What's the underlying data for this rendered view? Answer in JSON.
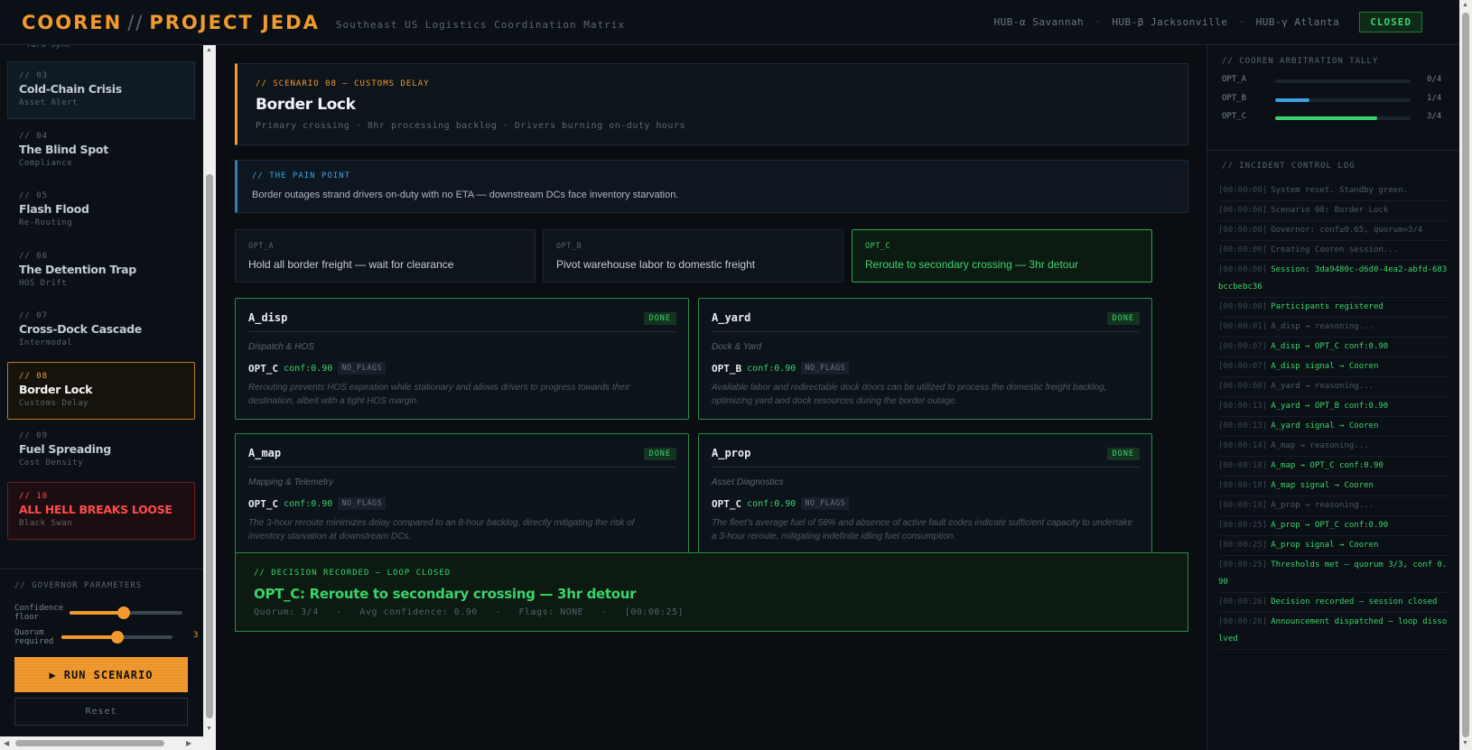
{
  "header": {
    "brand_left": "COOREN",
    "brand_sep": "//",
    "brand_right": "PROJECT JEDA",
    "subtitle": "Southeast US Logistics Coordination Matrix",
    "hubs": [
      "HUB-α Savannah",
      "HUB-β Jacksonville",
      "HUB-γ Atlanta"
    ],
    "status": "CLOSED",
    "status_color": "#3ad36c"
  },
  "sidebar": {
    "partial_top": "Yard Sync",
    "scenarios": [
      {
        "num": "// 03",
        "name": "Cold-Chain Crisis",
        "tag": "Asset Alert",
        "state": "hl"
      },
      {
        "num": "// 04",
        "name": "The Blind Spot",
        "tag": "Compliance",
        "state": ""
      },
      {
        "num": "// 05",
        "name": "Flash Flood",
        "tag": "Re-Routing",
        "state": ""
      },
      {
        "num": "// 06",
        "name": "The Detention Trap",
        "tag": "HOS Drift",
        "state": ""
      },
      {
        "num": "// 07",
        "name": "Cross-Dock Cascade",
        "tag": "Intermodal",
        "state": ""
      },
      {
        "num": "// 08",
        "name": "Border Lock",
        "tag": "Customs Delay",
        "state": "active"
      },
      {
        "num": "// 09",
        "name": "Fuel Spreading",
        "tag": "Cost Density",
        "state": ""
      },
      {
        "num": "// 10",
        "name": "ALL HELL BREAKS LOOSE",
        "tag": "Black Swan",
        "state": "danger"
      }
    ],
    "governor": {
      "title": "// GOVERNOR PARAMETERS",
      "confidence_label": "Confidence floor",
      "confidence_fraction": 0.48,
      "quorum_label": "Quorum required",
      "quorum_value": "3",
      "quorum_fraction": 0.5
    },
    "run_label": "RUN SCENARIO",
    "reset_label": "Reset"
  },
  "scenario": {
    "kicker": "// SCENARIO 08 — CUSTOMS DELAY",
    "title": "Border Lock",
    "desc": "Primary crossing · 8hr processing backlog · Drivers burning on-duty hours"
  },
  "pain": {
    "kicker": "// THE PAIN POINT",
    "text": "Border outages strand drivers on-duty with no ETA — downstream DCs face inventory starvation."
  },
  "options": [
    {
      "key": "OPT_A",
      "text": "Hold all border freight — wait for clearance",
      "selected": false
    },
    {
      "key": "OPT_B",
      "text": "Pivot warehouse labor to domestic freight",
      "selected": false
    },
    {
      "key": "OPT_C",
      "text": "Reroute to secondary crossing — 3hr detour",
      "selected": true
    }
  ],
  "agents": [
    {
      "name": "A_disp",
      "badge": "DONE",
      "role": "Dispatch & HOS",
      "pick": "OPT_C",
      "conf": "conf:0.90",
      "flag": "NO_FLAGS",
      "reason": "Rerouting prevents HOS expiration while stationary and allows drivers to progress towards their destination, albeit with a tight HOS margin."
    },
    {
      "name": "A_yard",
      "badge": "DONE",
      "role": "Dock & Yard",
      "pick": "OPT_B",
      "conf": "conf:0.90",
      "flag": "NO_FLAGS",
      "reason": "Available labor and redirectable dock doors can be utilized to process the domestic freight backlog, optimizing yard and dock resources during the border outage."
    },
    {
      "name": "A_map",
      "badge": "DONE",
      "role": "Mapping & Telemetry",
      "pick": "OPT_C",
      "conf": "conf:0.90",
      "flag": "NO_FLAGS",
      "reason": "The 3-hour reroute minimizes delay compared to an 8-hour backlog, directly mitigating the risk of inventory starvation at downstream DCs."
    },
    {
      "name": "A_prop",
      "badge": "DONE",
      "role": "Asset Diagnostics",
      "pick": "OPT_C",
      "conf": "conf:0.90",
      "flag": "NO_FLAGS",
      "reason": "The fleet's average fuel of 58% and absence of active fault codes indicate sufficient capacity to undertake a 3-hour reroute, mitigating indefinite idling fuel consumption."
    }
  ],
  "decision": {
    "kicker": "// DECISION RECORDED — LOOP CLOSED",
    "title": "OPT_C: Reroute to secondary crossing — 3hr detour",
    "meta": "Quorum: 3/4   ·   Avg confidence: 0.90   ·   Flags: NONE   ·   [00:00:25]"
  },
  "tally": {
    "title": "// COOREN ARBITRATION TALLY",
    "rows": [
      {
        "label": "OPT_A",
        "value": "0/4",
        "fraction": 0,
        "color": "#3ad36c"
      },
      {
        "label": "OPT_B",
        "value": "1/4",
        "fraction": 0.25,
        "color": "#3aa0e0"
      },
      {
        "label": "OPT_C",
        "value": "3/4",
        "fraction": 0.75,
        "color": "#3ad36c"
      }
    ]
  },
  "log": {
    "title": "// INCIDENT CONTROL LOG",
    "entries": [
      {
        "ts": "[00:00:00]",
        "msg": "System reset. Standby green.",
        "ok": false
      },
      {
        "ts": "[00:00:00]",
        "msg": "Scenario 08: Border Lock",
        "ok": false
      },
      {
        "ts": "[00:00:00]",
        "msg": "Governor: conf≥0.65, quorum=3/4",
        "ok": false
      },
      {
        "ts": "[00:00:00]",
        "msg": "Creating Cooren session...",
        "ok": false
      },
      {
        "ts": "[00:00:00]",
        "msg": "Session: 3da9480c-d6d0-4ea2-abfd-683bccbebc36",
        "ok": true
      },
      {
        "ts": "[00:00:00]",
        "msg": "Participants registered",
        "ok": true
      },
      {
        "ts": "[00:00:01]",
        "msg": "A_disp → reasoning...",
        "ok": false
      },
      {
        "ts": "[00:00:07]",
        "msg": "A_disp → OPT_C conf:0.90",
        "ok": true
      },
      {
        "ts": "[00:00:07]",
        "msg": "A_disp signal → Cooren",
        "ok": true
      },
      {
        "ts": "[00:00:08]",
        "msg": "A_yard → reasoning...",
        "ok": false
      },
      {
        "ts": "[00:00:13]",
        "msg": "A_yard → OPT_B conf:0.90",
        "ok": true
      },
      {
        "ts": "[00:00:13]",
        "msg": "A_yard signal → Cooren",
        "ok": true
      },
      {
        "ts": "[00:00:14]",
        "msg": "A_map → reasoning...",
        "ok": false
      },
      {
        "ts": "[00:00:18]",
        "msg": "A_map → OPT_C conf:0.90",
        "ok": true
      },
      {
        "ts": "[00:00:18]",
        "msg": "A_map signal → Cooren",
        "ok": true
      },
      {
        "ts": "[00:00:19]",
        "msg": "A_prop → reasoning...",
        "ok": false
      },
      {
        "ts": "[00:00:25]",
        "msg": "A_prop → OPT_C conf:0.90",
        "ok": true
      },
      {
        "ts": "[00:00:25]",
        "msg": "A_prop signal → Cooren",
        "ok": true
      },
      {
        "ts": "[00:00:25]",
        "msg": "Thresholds met — quorum 3/3, conf 0.90",
        "ok": true
      },
      {
        "ts": "[00:00:26]",
        "msg": "Decision recorded — session closed",
        "ok": true
      },
      {
        "ts": "[00:00:26]",
        "msg": "Announcement dispatched — loop dissolved",
        "ok": true
      }
    ]
  }
}
